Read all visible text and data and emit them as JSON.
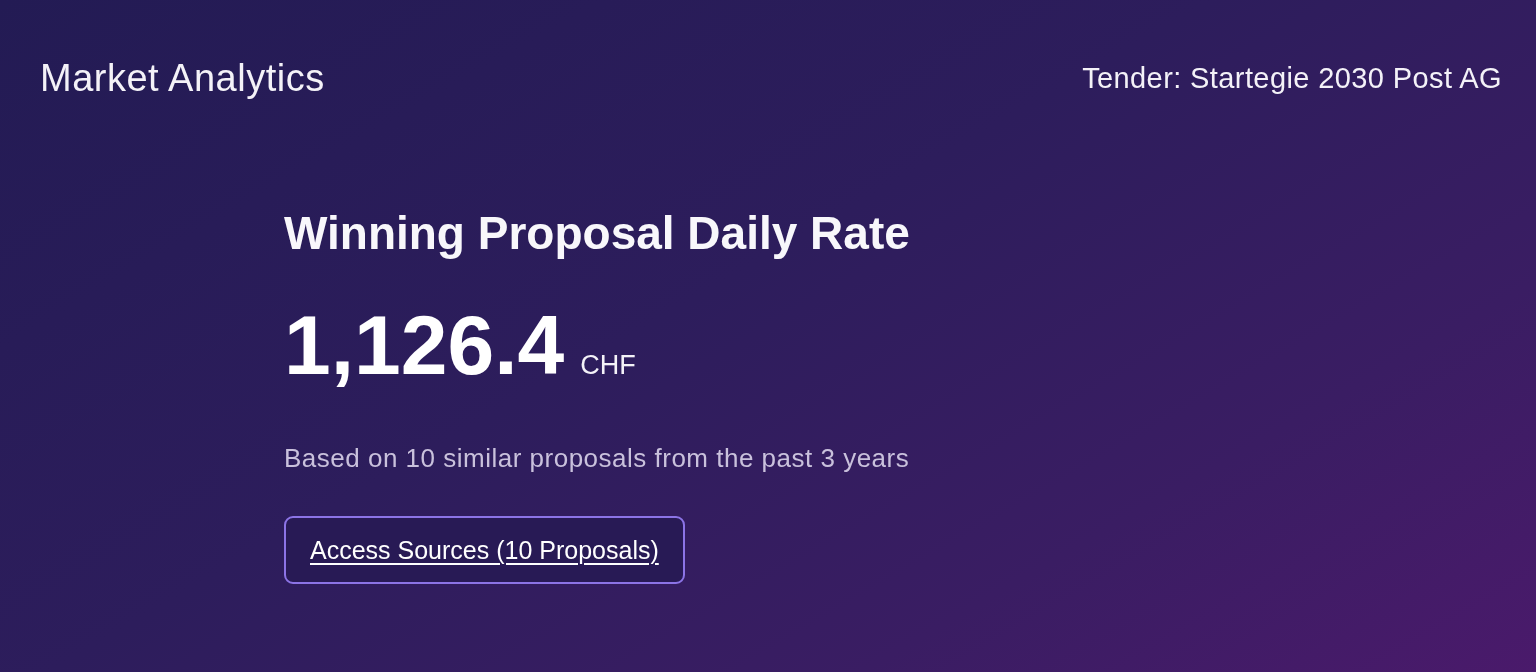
{
  "header": {
    "title": "Market Analytics",
    "tender": "Tender: Startegie 2030 Post AG"
  },
  "metric": {
    "title": "Winning Proposal Daily Rate",
    "value": "1,126.4",
    "unit": "CHF",
    "basis": "Based on 10 similar proposals from the past 3 years"
  },
  "sources_button": {
    "label": "Access Sources (10 Proposals)"
  }
}
